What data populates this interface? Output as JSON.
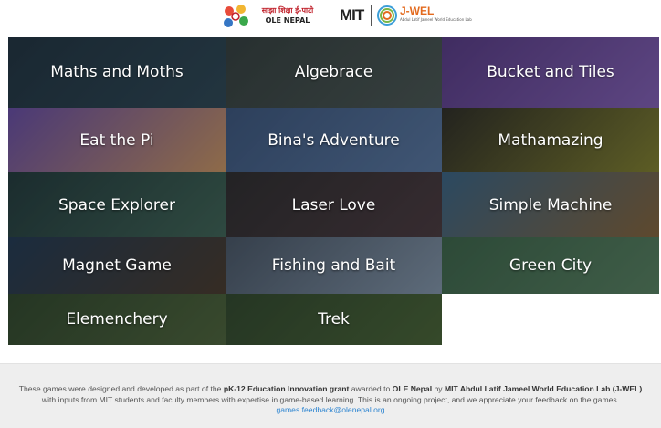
{
  "header": {
    "ole_nepali": "साझा शिक्षा ई-पाटी",
    "ole_name": "OLE NEPAL",
    "mit_logo": "MIT",
    "jwel_name": "J-WEL",
    "jwel_subtitle": "Abdul Latif Jameel World Education Lab"
  },
  "games": [
    {
      "label": "Maths and Moths",
      "colors": [
        "#1d3340",
        "#2b4957"
      ]
    },
    {
      "label": "Algebrace",
      "colors": [
        "#33403d",
        "#4b5a55"
      ]
    },
    {
      "label": "Bucket and Tiles",
      "colors": [
        "#5a3b8c",
        "#8a64c2"
      ]
    },
    {
      "label": "Eat the Pi",
      "colors": [
        "#6b4fb0",
        "#d9a066"
      ]
    },
    {
      "label": "Bina's Adventure",
      "colors": [
        "#3c5a84",
        "#5b7eab"
      ]
    },
    {
      "label": "Mathamazing",
      "colors": [
        "#2c2c22",
        "#8a8a2c"
      ]
    },
    {
      "label": "Space Explorer",
      "colors": [
        "#1f3b3b",
        "#3f6a58"
      ]
    },
    {
      "label": "Laser Love",
      "colors": [
        "#2c2c2c",
        "#4c3a3e"
      ]
    },
    {
      "label": "Simple Machine",
      "colors": [
        "#3a6a8c",
        "#8c6a3a"
      ]
    },
    {
      "label": "Magnet Game",
      "colors": [
        "#1f3a55",
        "#4a3a2a"
      ]
    },
    {
      "label": "Fishing and Bait",
      "colors": [
        "#4a5a6a",
        "#8aa0b5"
      ]
    },
    {
      "label": "Green City",
      "colors": [
        "#3c6a4a",
        "#5a8a64"
      ]
    },
    {
      "label": "Elemenchery",
      "colors": [
        "#2f4a2a",
        "#4f6a3a"
      ]
    },
    {
      "label": "Trek",
      "colors": [
        "#2f4a2a",
        "#4a6a34"
      ]
    }
  ],
  "footer": {
    "text_part1": "These games were designed and developed as part of the ",
    "grant": "pK-12 Education Innovation grant",
    "text_part2": " awarded to ",
    "org": "OLE Nepal",
    "text_part3": " by ",
    "lab": "MIT Abdul Latif Jameel World Education Lab (J-WEL)",
    "text_part4": " with inputs from MIT students and faculty members with expertise in game-based learning. This is an ongoing project, and we appreciate your feedback on the games.",
    "email": "games.feedback@olenepal.org"
  }
}
